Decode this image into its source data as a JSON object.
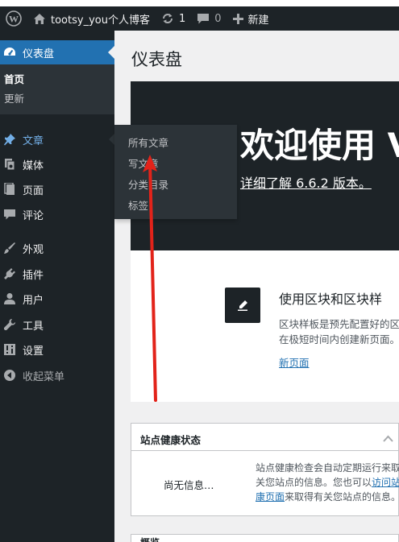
{
  "adminbar": {
    "site_name": "tootsy_you个人博客",
    "updates_count": "1",
    "comments_count": "0",
    "new_label": "新建"
  },
  "sidebar": {
    "dashboard_label": "仪表盘",
    "dashboard_submenu": {
      "home": "首页",
      "updates": "更新"
    },
    "items": [
      {
        "label": "文章",
        "icon": "pin-icon"
      },
      {
        "label": "媒体",
        "icon": "media-icon"
      },
      {
        "label": "页面",
        "icon": "page-icon"
      },
      {
        "label": "评论",
        "icon": "comment-icon"
      },
      {
        "label": "外观",
        "icon": "brush-icon"
      },
      {
        "label": "插件",
        "icon": "plugin-icon"
      },
      {
        "label": "用户",
        "icon": "user-icon"
      },
      {
        "label": "工具",
        "icon": "wrench-icon"
      },
      {
        "label": "设置",
        "icon": "settings-icon"
      },
      {
        "label": "收起菜单",
        "icon": "collapse-icon"
      }
    ],
    "posts_flyout": [
      "所有文章",
      "写文章",
      "分类目录",
      "标签"
    ]
  },
  "main": {
    "page_title": "仪表盘",
    "welcome": {
      "heading": "欢迎使用 V",
      "link": "详细了解 6.6.2 版本。",
      "block_title": "使用区块和区块样",
      "block_desc_lines": [
        "区块样板是预先配置好的区",
        "在极短时间内创建新页面。"
      ],
      "block_link": "新页面"
    },
    "health": {
      "title": "站点健康状态",
      "no_info": "尚无信息…",
      "desc_line1": "站点健康检查会自动定期运行来取",
      "desc_line2_pre": "关您站点的信息。您也可以",
      "desc_line2_link": "访问站",
      "desc_line3_link": "康页面",
      "desc_line3_post": "来取得有关您站点的信息。"
    },
    "next_box_title": "概览"
  },
  "colors": {
    "admin_dark": "#1d2327",
    "submenu_dark": "#2c3338",
    "accent_blue": "#2271b1",
    "active_link": "#72aee6",
    "annotation_red": "#e2231a"
  }
}
